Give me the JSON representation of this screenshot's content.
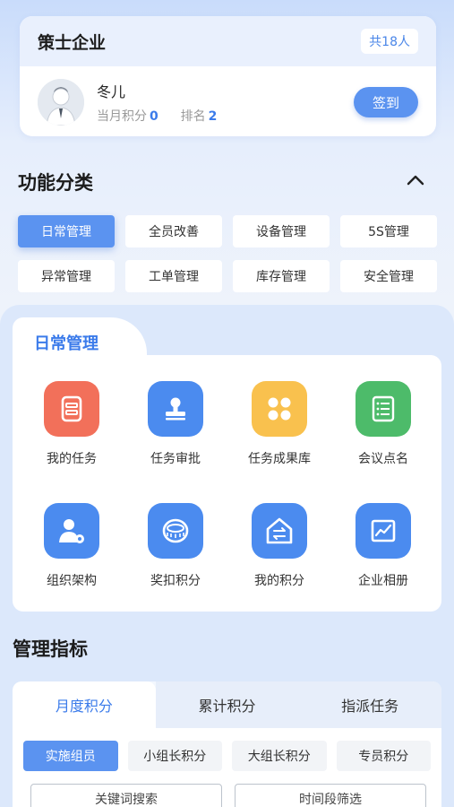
{
  "company": {
    "name": "策士企业",
    "members": "共18人"
  },
  "user": {
    "name": "冬儿",
    "points_label": "当月积分",
    "points": "0",
    "rank_label": "排名",
    "rank": "2",
    "signin": "签到"
  },
  "functions_section": {
    "title": "功能分类"
  },
  "categories": [
    "日常管理",
    "全员改善",
    "设备管理",
    "5S管理",
    "异常管理",
    "工单管理",
    "库存管理",
    "安全管理"
  ],
  "active_category": "日常管理",
  "panel": {
    "title": "日常管理",
    "items": [
      {
        "label": "我的任务",
        "icon": "task-icon",
        "color": "#f2705a"
      },
      {
        "label": "任务审批",
        "icon": "stamp-icon",
        "color": "#4b8bef"
      },
      {
        "label": "任务成果库",
        "icon": "grid-dots-icon",
        "color": "#f9c14e"
      },
      {
        "label": "会议点名",
        "icon": "list-icon",
        "color": "#4dbb6a"
      },
      {
        "label": "组织架构",
        "icon": "person-settings-icon",
        "color": "#4b8bef"
      },
      {
        "label": "奖扣积分",
        "icon": "tape-icon",
        "color": "#4b8bef"
      },
      {
        "label": "我的积分",
        "icon": "house-transfer-icon",
        "color": "#4b8bef"
      },
      {
        "label": "企业相册",
        "icon": "chart-frame-icon",
        "color": "#4b8bef"
      }
    ]
  },
  "metrics": {
    "title": "管理指标",
    "tabs": [
      "月度积分",
      "累计积分",
      "指派任务"
    ],
    "sub_tabs": [
      "实施组员",
      "小组长积分",
      "大组长积分",
      "专员积分"
    ],
    "filters": [
      "关键词搜索",
      "时间段筛选"
    ]
  },
  "colors": {
    "accent": "#5b93f0",
    "accent_text": "#3b7bea"
  }
}
